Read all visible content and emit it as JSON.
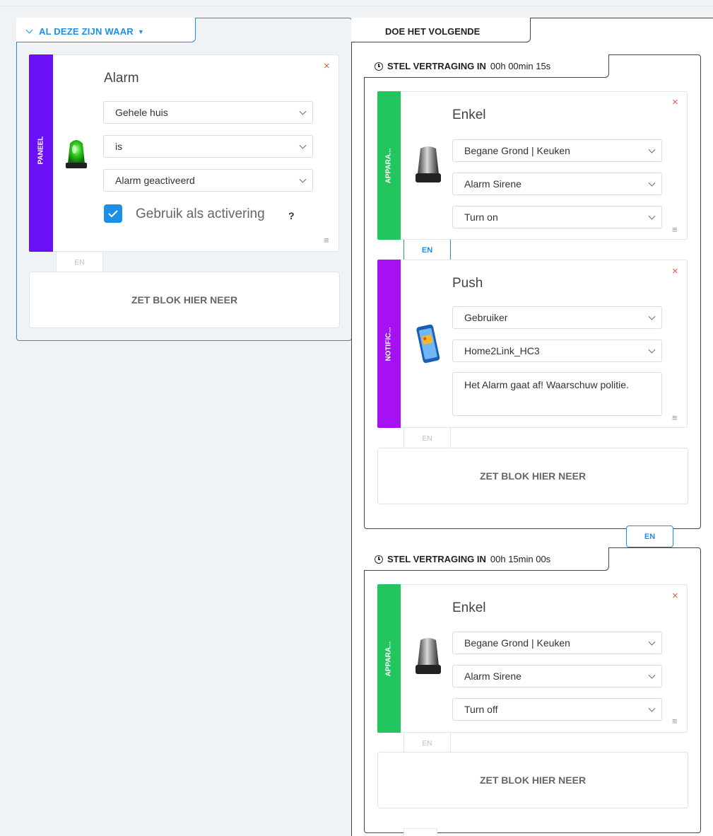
{
  "condition": {
    "header": "AL DEZE ZIJN WAAR",
    "block": {
      "type_label": "PANEEL",
      "color": "#6a10f5",
      "title": "Alarm",
      "icon": "green-siren-icon",
      "selects": [
        "Gehele huis",
        "is",
        "Alarm geactiveerd"
      ],
      "checkbox_checked": true,
      "checkbox_label": "Gebruik als activering",
      "help": "?"
    },
    "and_label": "EN",
    "drop_label": "ZET BLOK HIER NEER"
  },
  "actions": {
    "header": "DOE HET VOLGENDE",
    "groups": [
      {
        "delay_label": "STEL VERTRAGING IN",
        "delay_value": "00h 00min 15s",
        "blocks": [
          {
            "type_label": "APPARA...",
            "color": "#22c55e",
            "title": "Enkel",
            "icon": "siren-icon",
            "selects": [
              "Begane Grond | Keuken",
              "Alarm Sirene",
              "Turn on"
            ]
          },
          {
            "type_label": "NOTIFIC...",
            "color": "#a511f0",
            "title": "Push",
            "icon": "phone-notification-icon",
            "selects": [
              "Gebruiker",
              "Home2Link_HC3"
            ],
            "message": "Het Alarm gaat af! Waarschuw politie."
          }
        ],
        "and_label": "EN",
        "drop_label": "ZET BLOK HIER NEER"
      },
      {
        "delay_label": "STEL VERTRAGING IN",
        "delay_value": "00h 15min 00s",
        "blocks": [
          {
            "type_label": "APPARA...",
            "color": "#22c55e",
            "title": "Enkel",
            "icon": "siren-icon",
            "selects": [
              "Begane Grond | Keuken",
              "Alarm Sirene",
              "Turn off"
            ]
          }
        ],
        "and_label": "EN",
        "drop_label": "ZET BLOK HIER NEER"
      }
    ],
    "between_groups_and": "EN"
  },
  "icons": {
    "close": "×",
    "drag": "≡"
  }
}
